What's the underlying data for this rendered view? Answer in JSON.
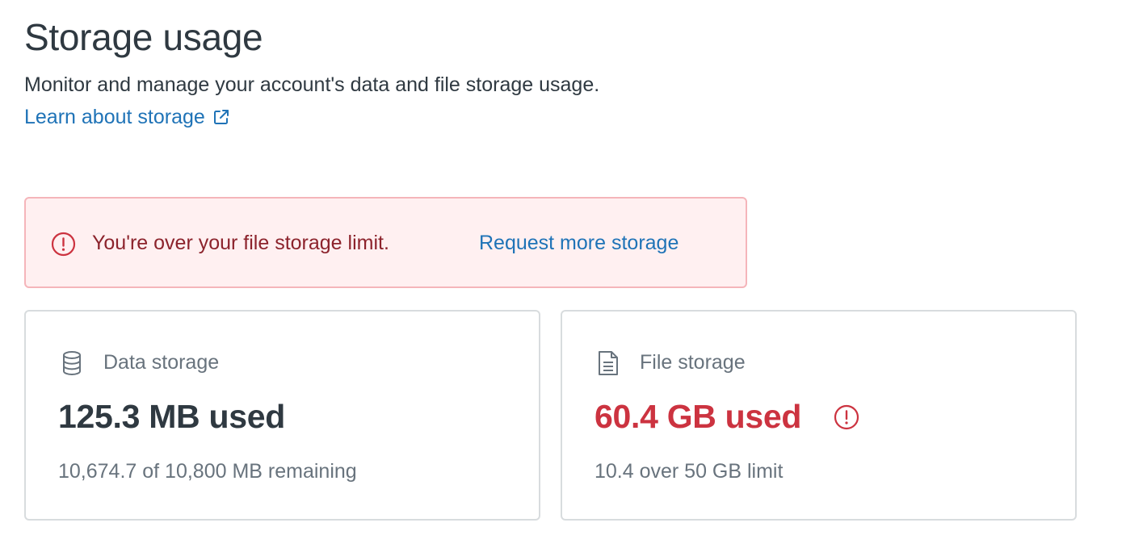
{
  "header": {
    "title": "Storage usage",
    "description": "Monitor and manage your account's data and file storage usage.",
    "learn_link_label": "Learn about storage",
    "learn_link_icon": "external-link-icon"
  },
  "alert": {
    "icon": "alert-circle-icon",
    "message": "You're over your file storage limit.",
    "action_label": "Request more storage",
    "background_color": "#fff0f1",
    "border_color": "#f5b5ba",
    "text_color": "#8c232c"
  },
  "cards": {
    "data": {
      "icon": "database-icon",
      "label": "Data storage",
      "used": "125.3 MB used",
      "detail": "10,674.7 of 10,800 MB remaining"
    },
    "file": {
      "icon": "document-icon",
      "label": "File storage",
      "used": "60.4 GB used",
      "warning_icon": "alert-circle-icon",
      "detail": "10.4 over 50 GB limit",
      "status_color": "#cc3340"
    }
  },
  "colors": {
    "link": "#1f73b7",
    "text_primary": "#2f3941",
    "text_secondary": "#68737d",
    "danger": "#cc3340"
  }
}
